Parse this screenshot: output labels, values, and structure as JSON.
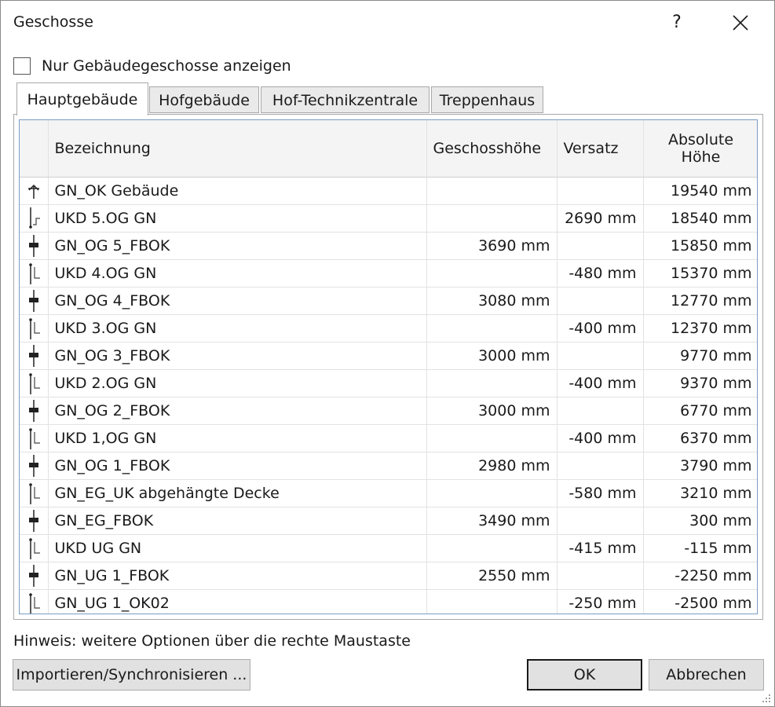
{
  "window": {
    "title": "Geschosse",
    "help_label": "?"
  },
  "options": {
    "only_building_levels_label": "Nur Gebäudegeschosse anzeigen",
    "only_building_levels_checked": false
  },
  "tabs": [
    {
      "label": "Hauptgebäude",
      "active": true
    },
    {
      "label": "Hofgebäude",
      "active": false
    },
    {
      "label": "Hof-Technikzentrale",
      "active": false
    },
    {
      "label": "Treppenhaus",
      "active": false
    }
  ],
  "table": {
    "columns": {
      "name": "Bezeichnung",
      "height": "Geschosshöhe",
      "offset": "Versatz",
      "absolute_line1": "Absolute",
      "absolute_line2": "Höhe"
    },
    "rows": [
      {
        "icon": "top-level-icon",
        "name": "GN_OK Gebäude",
        "height": "",
        "offset": "",
        "absolute": "19540 mm"
      },
      {
        "icon": "offset-up-icon",
        "name": "UKD 5.OG GN",
        "height": "",
        "offset": "2690 mm",
        "absolute": "18540 mm"
      },
      {
        "icon": "level-icon",
        "name": "GN_OG 5_FBOK",
        "height": "3690 mm",
        "offset": "",
        "absolute": "15850 mm"
      },
      {
        "icon": "offset-down-icon",
        "name": "UKD 4.OG GN",
        "height": "",
        "offset": "-480 mm",
        "absolute": "15370 mm"
      },
      {
        "icon": "level-icon",
        "name": "GN_OG 4_FBOK",
        "height": "3080 mm",
        "offset": "",
        "absolute": "12770 mm"
      },
      {
        "icon": "offset-down-icon",
        "name": "UKD 3.OG GN",
        "height": "",
        "offset": "-400 mm",
        "absolute": "12370 mm"
      },
      {
        "icon": "level-icon",
        "name": "GN_OG 3_FBOK",
        "height": "3000 mm",
        "offset": "",
        "absolute": "9770 mm"
      },
      {
        "icon": "offset-down-icon",
        "name": "UKD 2.OG GN",
        "height": "",
        "offset": "-400 mm",
        "absolute": "9370 mm"
      },
      {
        "icon": "level-icon",
        "name": "GN_OG 2_FBOK",
        "height": "3000 mm",
        "offset": "",
        "absolute": "6770 mm"
      },
      {
        "icon": "offset-down-icon",
        "name": "UKD 1,OG GN",
        "height": "",
        "offset": "-400 mm",
        "absolute": "6370 mm"
      },
      {
        "icon": "level-icon",
        "name": "GN_OG 1_FBOK",
        "height": "2980 mm",
        "offset": "",
        "absolute": "3790 mm"
      },
      {
        "icon": "offset-down-icon",
        "name": "GN_EG_UK abgehängte Decke",
        "height": "",
        "offset": "-580 mm",
        "absolute": "3210 mm"
      },
      {
        "icon": "level-icon",
        "name": "GN_EG_FBOK",
        "height": "3490 mm",
        "offset": "",
        "absolute": "300 mm"
      },
      {
        "icon": "offset-down-icon",
        "name": "UKD UG GN",
        "height": "",
        "offset": "-415 mm",
        "absolute": "-115 mm"
      },
      {
        "icon": "level-icon",
        "name": "GN_UG 1_FBOK",
        "height": "2550 mm",
        "offset": "",
        "absolute": "-2250 mm"
      },
      {
        "icon": "offset-down-icon",
        "name": "GN_UG 1_OK02",
        "height": "",
        "offset": "-250 mm",
        "absolute": "-2500 mm"
      }
    ]
  },
  "footer": {
    "hint": "Hinweis: weitere Optionen über die rechte Maustaste",
    "import_label": "Importieren/Synchronisieren ...",
    "ok_label": "OK",
    "cancel_label": "Abbrechen"
  }
}
